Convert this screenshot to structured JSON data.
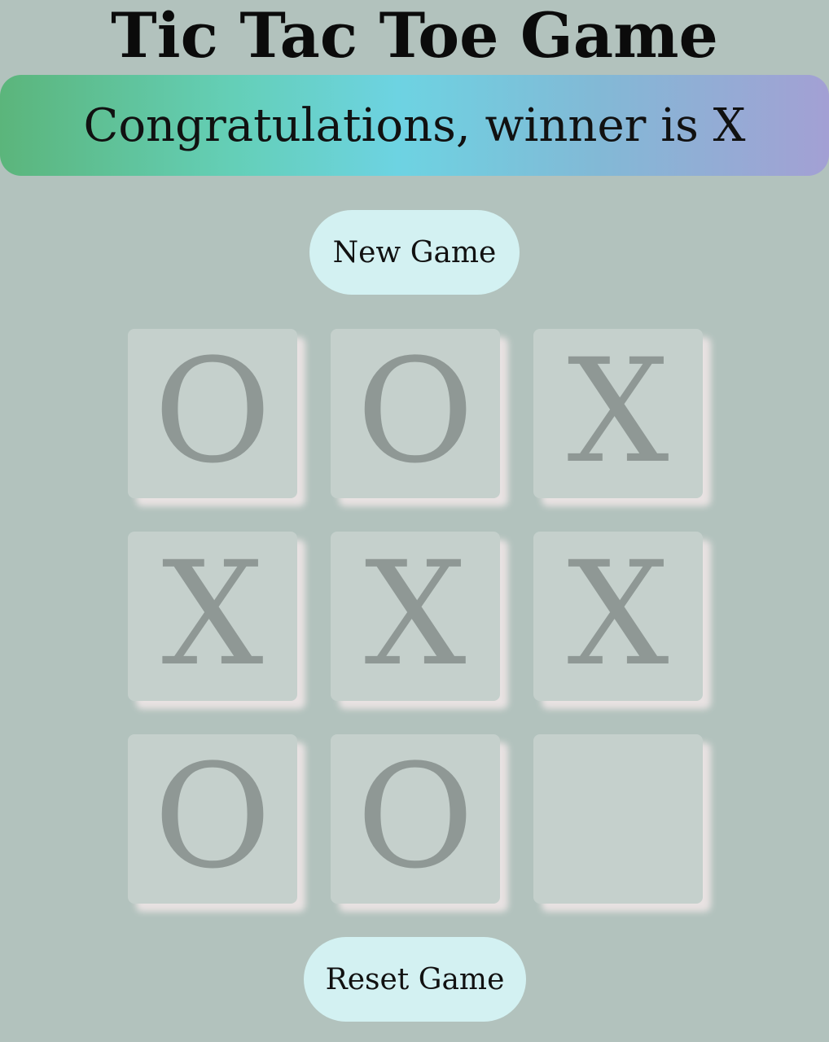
{
  "title": "Tic Tac Toe Game",
  "status_message": "Congratulations, winner is X",
  "buttons": {
    "new_game": "New Game",
    "reset_game": "Reset Game"
  },
  "board": {
    "cells": [
      "O",
      "O",
      "X",
      "X",
      "X",
      "X",
      "O",
      "O",
      ""
    ]
  },
  "colors": {
    "background": "#b2c2bd",
    "cell": "#c5d0cc",
    "mark": "#8f9895",
    "button": "#d3f1f2",
    "banner_gradient": [
      "#5bb57b",
      "#6dd3e2",
      "#a3a0d4"
    ]
  }
}
